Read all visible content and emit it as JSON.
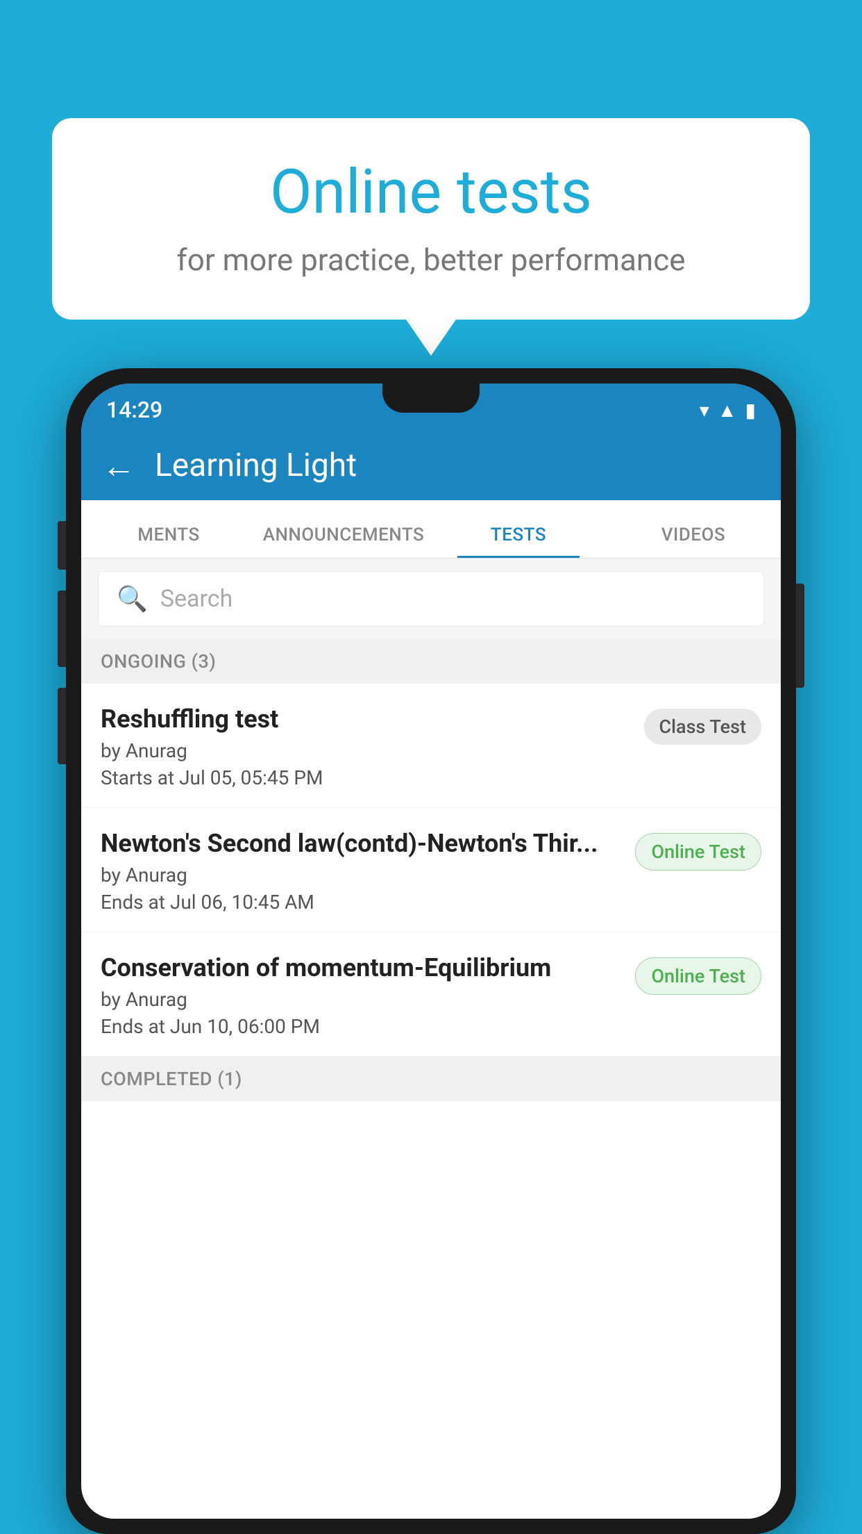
{
  "background_color": "#1EACD9",
  "speech_bubble": {
    "title": "Online tests",
    "subtitle": "for more practice, better performance"
  },
  "status_bar": {
    "time": "14:29",
    "icons": [
      "wifi",
      "signal",
      "battery"
    ]
  },
  "app_bar": {
    "back_label": "←",
    "title": "Learning Light"
  },
  "tabs": [
    {
      "label": "MENTS",
      "active": false
    },
    {
      "label": "ANNOUNCEMENTS",
      "active": false
    },
    {
      "label": "TESTS",
      "active": true
    },
    {
      "label": "VIDEOS",
      "active": false
    }
  ],
  "search": {
    "placeholder": "Search"
  },
  "ongoing_section": {
    "label": "ONGOING (3)"
  },
  "tests": [
    {
      "title": "Reshuffling test",
      "author": "by Anurag",
      "date": "Starts at  Jul 05, 05:45 PM",
      "badge": "Class Test",
      "badge_type": "class"
    },
    {
      "title": "Newton's Second law(contd)-Newton's Thir...",
      "author": "by Anurag",
      "date": "Ends at  Jul 06, 10:45 AM",
      "badge": "Online Test",
      "badge_type": "online"
    },
    {
      "title": "Conservation of momentum-Equilibrium",
      "author": "by Anurag",
      "date": "Ends at  Jun 10, 06:00 PM",
      "badge": "Online Test",
      "badge_type": "online"
    }
  ],
  "completed_section": {
    "label": "COMPLETED (1)"
  }
}
